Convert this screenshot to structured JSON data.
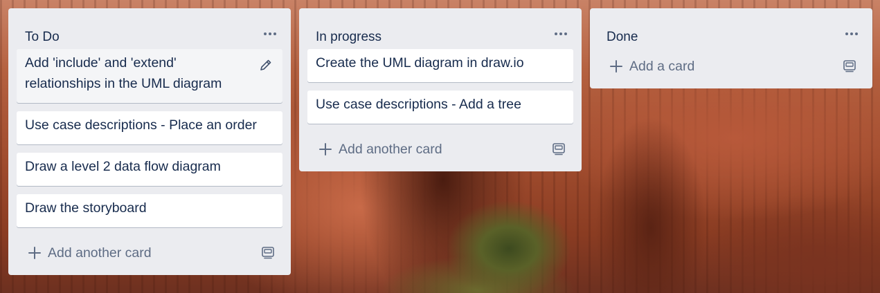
{
  "lists": [
    {
      "title": "To Do",
      "cards": [
        {
          "line1": "Add 'include' and 'extend'",
          "line2": "relationships in the UML diagram"
        },
        {
          "line1": "Use case descriptions - Place an order"
        },
        {
          "line1": "Draw a level 2 data flow diagram"
        },
        {
          "line1": "Draw the storyboard"
        }
      ],
      "add_label": "Add another card"
    },
    {
      "title": "In progress",
      "cards": [
        {
          "line1": "Create the UML diagram in draw.io"
        },
        {
          "line1": "Use case descriptions - Add a tree"
        }
      ],
      "add_label": "Add another card"
    },
    {
      "title": "Done",
      "cards": [],
      "add_label": "Add a card"
    }
  ],
  "icons": {
    "menu": "more-horizontal-icon",
    "edit": "pencil-icon",
    "add": "plus-icon",
    "template": "card-template-icon"
  },
  "colors": {
    "list_bg": "#ebecf0",
    "card_bg": "#ffffff",
    "text": "#172b4d",
    "muted": "#5e6c84"
  }
}
